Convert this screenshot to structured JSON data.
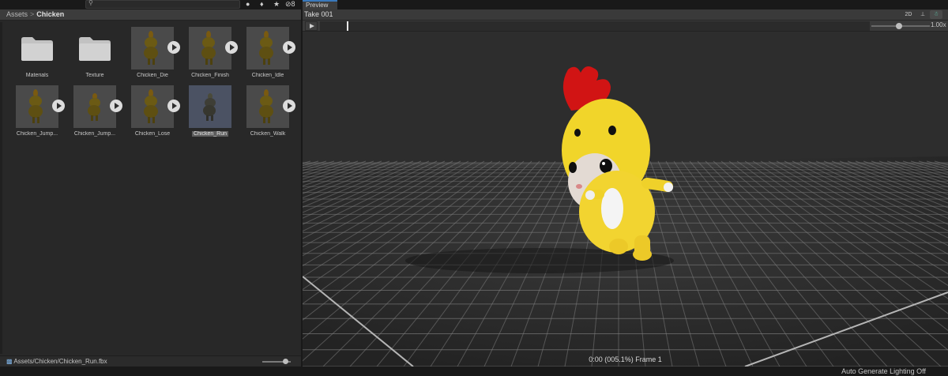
{
  "project": {
    "breadcrumb": {
      "root": "Assets",
      "separator": ">",
      "current": "Chicken"
    },
    "toolbar": {
      "hidden_count": "8"
    },
    "assets": [
      {
        "label": "Materials",
        "kind": "folder"
      },
      {
        "label": "Texture",
        "kind": "folder"
      },
      {
        "label": "Chicken_Die",
        "kind": "model"
      },
      {
        "label": "Chicken_Finish",
        "kind": "model"
      },
      {
        "label": "Chicken_Idle",
        "kind": "model"
      },
      {
        "label": "Chicken_Jump...",
        "kind": "model"
      },
      {
        "label": "Chicken_Jump...",
        "kind": "model"
      },
      {
        "label": "Chicken_Lose",
        "kind": "model"
      },
      {
        "label": "Chicken_Run",
        "kind": "model",
        "selected": true
      },
      {
        "label": "Chicken_Walk",
        "kind": "model"
      }
    ],
    "footer_path": "Assets/Chicken/Chicken_Run.fbx"
  },
  "preview": {
    "tab_label": "Preview",
    "clip_name": "Take 001",
    "btn_2d": "2D",
    "speed": "1.00x",
    "frame_info": "0:00 (005.1%) Frame 1"
  },
  "status_bar": {
    "text": "Auto Generate Lighting Off"
  },
  "colors": {
    "accent": "#3a79bb",
    "panel": "#282828",
    "viewport": "#2d2d2d"
  }
}
